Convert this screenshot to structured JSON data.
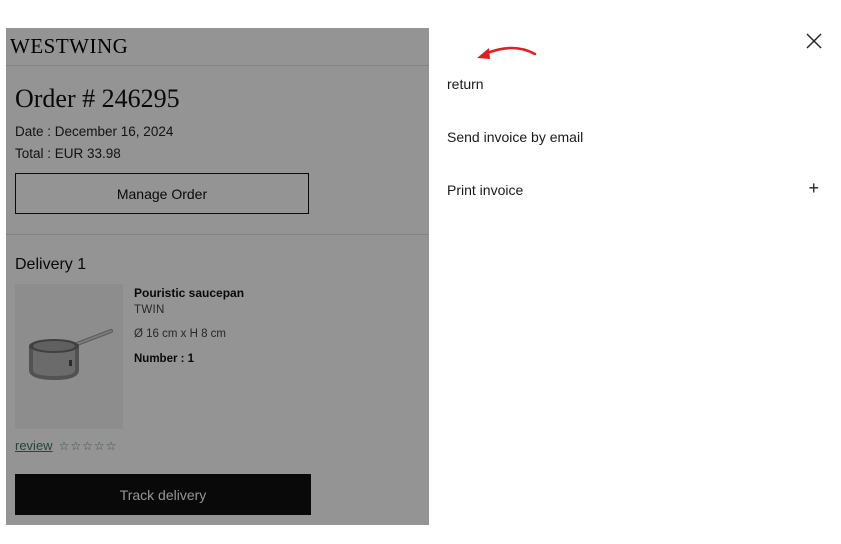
{
  "order": {
    "brand_logo": "WESTWING",
    "title": "Order # 246295",
    "date_line": "Date :  December 16, 2024",
    "total_line": "Total : EUR 33.98",
    "manage_button": "Manage Order",
    "delivery_title": "Delivery 1",
    "product": {
      "name": "Pouristic saucepan",
      "brand": "TWIN",
      "dimensions": "Ø 16 cm x H 8 cm",
      "quantity": "Number : 1"
    },
    "review_link": "review",
    "stars": "☆☆☆☆☆",
    "track_button": "Track delivery"
  },
  "drawer": {
    "items": [
      {
        "label": "return"
      },
      {
        "label": "Send invoice by email"
      },
      {
        "label": "Print invoice"
      }
    ],
    "expand_symbol": "+"
  },
  "colors": {
    "annotation_arrow": "#e02020",
    "overlay": "rgba(0,0,0,0.42)",
    "review_link": "#3d7a6b"
  }
}
